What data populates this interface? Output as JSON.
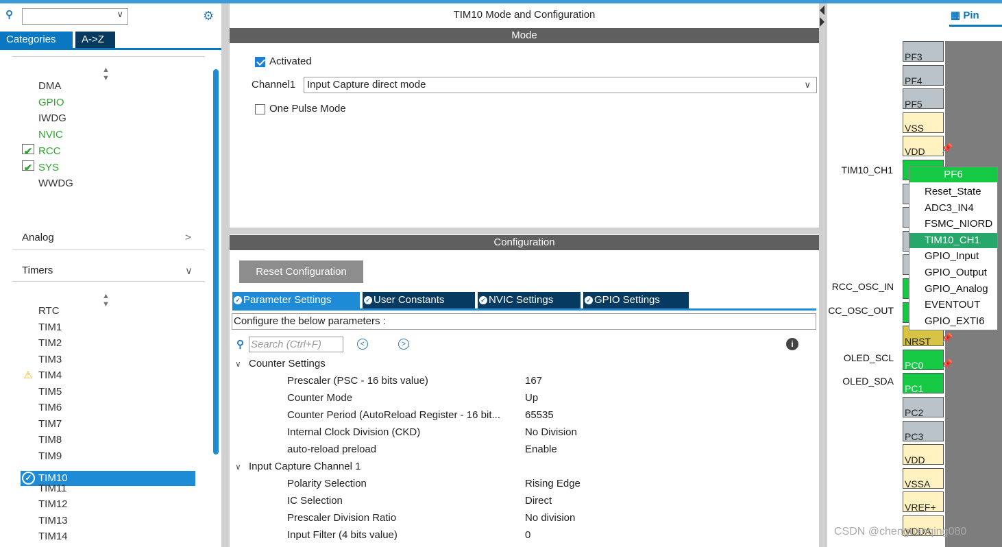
{
  "left": {
    "search_value": "",
    "tabs": [
      "Categories",
      "A->Z"
    ],
    "system_items": [
      {
        "label": "DMA",
        "status": "none"
      },
      {
        "label": "GPIO",
        "status": "green"
      },
      {
        "label": "IWDG",
        "status": "none"
      },
      {
        "label": "NVIC",
        "status": "green"
      },
      {
        "label": "RCC",
        "status": "check"
      },
      {
        "label": "SYS",
        "status": "check"
      },
      {
        "label": "WWDG",
        "status": "none"
      }
    ],
    "analog_label": "Analog",
    "timers_label": "Timers",
    "timer_items": [
      {
        "label": "RTC",
        "status": "none"
      },
      {
        "label": "TIM1",
        "status": "none"
      },
      {
        "label": "TIM2",
        "status": "none"
      },
      {
        "label": "TIM3",
        "status": "none"
      },
      {
        "label": "TIM4",
        "status": "warn"
      },
      {
        "label": "TIM5",
        "status": "none"
      },
      {
        "label": "TIM6",
        "status": "none"
      },
      {
        "label": "TIM7",
        "status": "none"
      },
      {
        "label": "TIM8",
        "status": "none"
      },
      {
        "label": "TIM9",
        "status": "none"
      },
      {
        "label": "TIM10",
        "status": "selected"
      },
      {
        "label": "TIM11",
        "status": "none"
      },
      {
        "label": "TIM12",
        "status": "none"
      },
      {
        "label": "TIM13",
        "status": "none"
      },
      {
        "label": "TIM14",
        "status": "none"
      }
    ]
  },
  "center": {
    "title": "TIM10 Mode and Configuration",
    "mode_bar": "Mode",
    "activated_label": "Activated",
    "activated": true,
    "channel_label": "Channel1",
    "channel_value": "Input Capture direct mode",
    "one_pulse_label": "One Pulse Mode",
    "one_pulse": false,
    "config_bar": "Configuration",
    "reset_button": "Reset Configuration",
    "tabs": [
      "Parameter Settings",
      "User Constants",
      "NVIC Settings",
      "GPIO Settings"
    ],
    "configure_text": "Configure the below parameters :",
    "search_placeholder": "Search (Ctrl+F)",
    "groups": [
      {
        "name": "Counter Settings",
        "params": [
          {
            "name": "Prescaler (PSC - 16 bits value)",
            "value": "167"
          },
          {
            "name": "Counter Mode",
            "value": "Up"
          },
          {
            "name": "Counter Period (AutoReload Register - 16 bit...",
            "value": "65535"
          },
          {
            "name": "Internal Clock Division (CKD)",
            "value": "No Division"
          },
          {
            "name": "auto-reload preload",
            "value": "Enable"
          }
        ]
      },
      {
        "name": "Input Capture Channel 1",
        "params": [
          {
            "name": "Polarity Selection",
            "value": "Rising Edge"
          },
          {
            "name": "IC Selection",
            "value": "Direct"
          },
          {
            "name": "Prescaler Division Ratio",
            "value": "No division"
          },
          {
            "name": "Input Filter (4 bits value)",
            "value": "0"
          }
        ]
      }
    ]
  },
  "right": {
    "tab_label": "Pin",
    "pins": [
      {
        "label": "PF3",
        "color": "gray"
      },
      {
        "label": "PF4",
        "color": "gray"
      },
      {
        "label": "PF5",
        "color": "gray"
      },
      {
        "label": "VSS",
        "color": "yel"
      },
      {
        "label": "VDD",
        "color": "yel"
      },
      {
        "label": "",
        "color": "grn"
      },
      {
        "label": "",
        "color": "gray"
      },
      {
        "label": "",
        "color": "gray"
      },
      {
        "label": "",
        "color": "gray"
      },
      {
        "label": "",
        "color": "gray"
      },
      {
        "label": "",
        "color": "grn"
      },
      {
        "label": "",
        "color": "grn"
      },
      {
        "label": "NRST",
        "color": "olive"
      },
      {
        "label": "PC0",
        "color": "grn"
      },
      {
        "label": "PC1",
        "color": "grn"
      },
      {
        "label": "PC2",
        "color": "gray"
      },
      {
        "label": "PC3",
        "color": "gray"
      },
      {
        "label": "VDD",
        "color": "yel"
      },
      {
        "label": "VSSA",
        "color": "yel"
      },
      {
        "label": "VREF+",
        "color": "yel"
      },
      {
        "label": "VDDA",
        "color": "yel"
      }
    ],
    "signals": {
      "tim10": "TIM10_CH1",
      "rcc_in": "RCC_OSC_IN",
      "rcc_out": "CC_OSC_OUT",
      "oled_scl": "OLED_SCL",
      "oled_sda": "OLED_SDA"
    },
    "popup": {
      "header": "PF6",
      "items": [
        "Reset_State",
        "ADC3_IN4",
        "FSMC_NIORD",
        "TIM10_CH1",
        "GPIO_Input",
        "GPIO_Output",
        "GPIO_Analog",
        "EVENTOUT",
        "GPIO_EXTI6"
      ],
      "selected": "TIM10_CH1"
    },
    "watermark": "CSDN @chenguanqing080"
  },
  "colors": {
    "accent": "#1e8bd6",
    "dark_tab": "#073a60",
    "pin_green": "#16c945",
    "check_green": "#2ba82b"
  }
}
